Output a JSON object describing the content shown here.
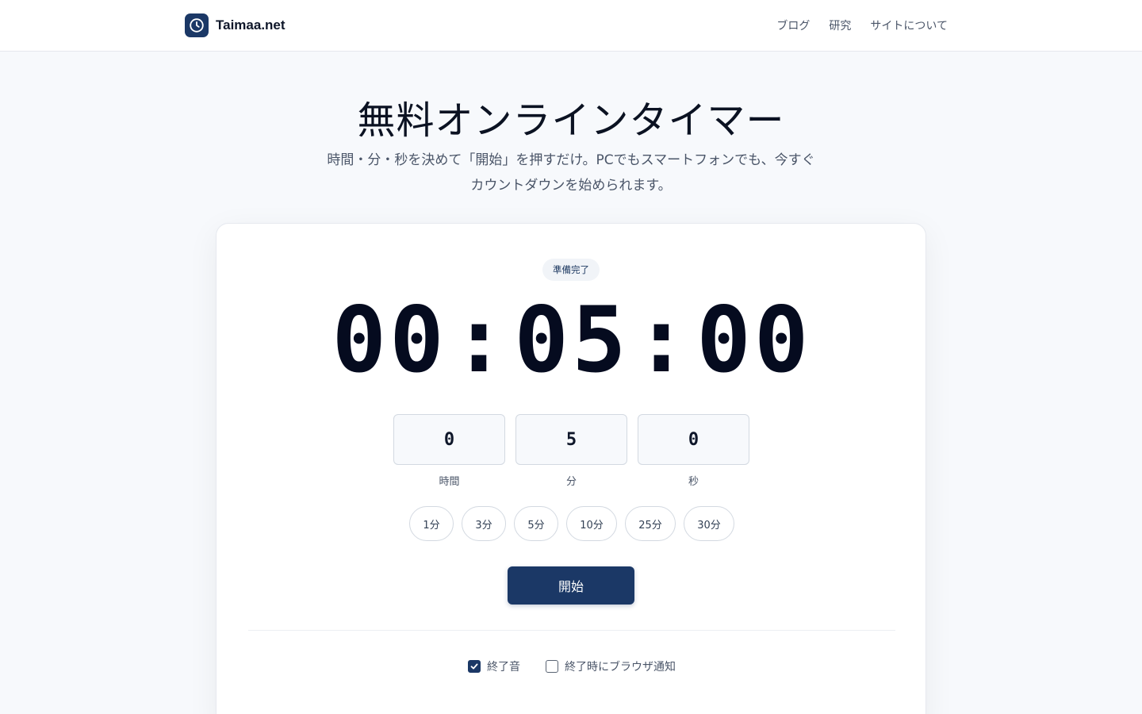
{
  "header": {
    "brand": "Taimaa.net",
    "nav": [
      "ブログ",
      "研究",
      "サイトについて"
    ]
  },
  "hero": {
    "title": "無料オンラインタイマー",
    "subtitle_line1": "時間・分・秒を決めて「開始」を押すだけ。PCでもスマートフォンでも、今すぐ",
    "subtitle_line2": "カウントダウンを始められます。"
  },
  "timer": {
    "status": "準備完了",
    "hours": "00",
    "minutes": "05",
    "seconds": "00",
    "separator": ":"
  },
  "inputs": [
    {
      "value": "0",
      "label": "時間"
    },
    {
      "value": "5",
      "label": "分"
    },
    {
      "value": "0",
      "label": "秒"
    }
  ],
  "presets": [
    "1分",
    "3分",
    "5分",
    "10分",
    "25分",
    "30分"
  ],
  "start_label": "開始",
  "options": [
    {
      "label": "終了音",
      "checked": true
    },
    {
      "label": "終了時にブラウザ通知",
      "checked": false
    }
  ],
  "colors": {
    "primary": "#1b3866",
    "background": "#f7f9fc",
    "text": "#0f172a",
    "muted": "#4a5568"
  },
  "icons": {
    "brand": "clock-icon",
    "checked": "checkmark-icon"
  }
}
